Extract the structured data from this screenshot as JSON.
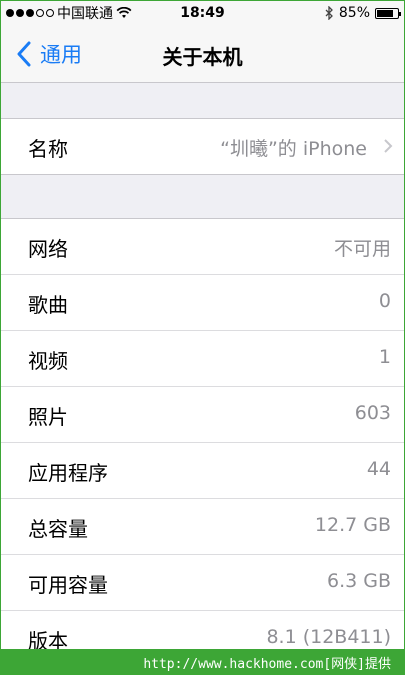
{
  "status_bar": {
    "carrier": "中国联通",
    "time": "18:49",
    "battery_percent": "85%",
    "battery_level": 0.85,
    "signal_dots_full": 3,
    "signal_dots_total": 5
  },
  "nav": {
    "back_label": "通用",
    "title": "关于本机"
  },
  "name_section": {
    "label": "名称",
    "value": "“圳曦”的 iPhone"
  },
  "info_rows": [
    {
      "label": "网络",
      "value": "不可用"
    },
    {
      "label": "歌曲",
      "value": "0"
    },
    {
      "label": "视频",
      "value": "1"
    },
    {
      "label": "照片",
      "value": "603"
    },
    {
      "label": "应用程序",
      "value": "44"
    },
    {
      "label": "总容量",
      "value": "12.7 GB"
    },
    {
      "label": "可用容量",
      "value": "6.3 GB"
    },
    {
      "label": "版本",
      "value": "8.1 (12B411)"
    }
  ],
  "footer": {
    "watermark": "http://www.hackhome.com[网侠]提供"
  },
  "colors": {
    "accent": "#1a7cf5",
    "secondary_text": "#8e8e93",
    "watermark_bar": "#3da636"
  }
}
